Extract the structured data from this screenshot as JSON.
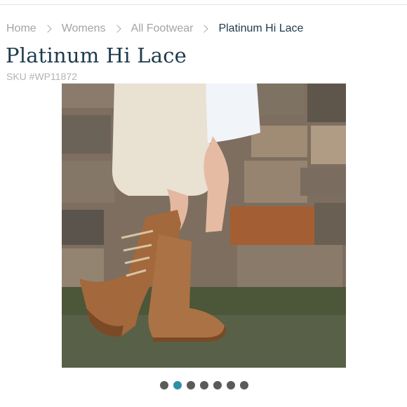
{
  "breadcrumb": {
    "items": [
      {
        "label": "Home"
      },
      {
        "label": "Womens"
      },
      {
        "label": "All Footwear"
      },
      {
        "label": "Platinum Hi Lace"
      }
    ]
  },
  "product": {
    "title": "Platinum Hi Lace",
    "sku": "SKU #WP11872",
    "image_alt": "chestnut-lace-up-sheepskin-boots"
  },
  "carousel": {
    "count": 7,
    "active_index": 1,
    "colors": {
      "inactive": "#5a5a5a",
      "active": "#2f8fa7"
    }
  }
}
